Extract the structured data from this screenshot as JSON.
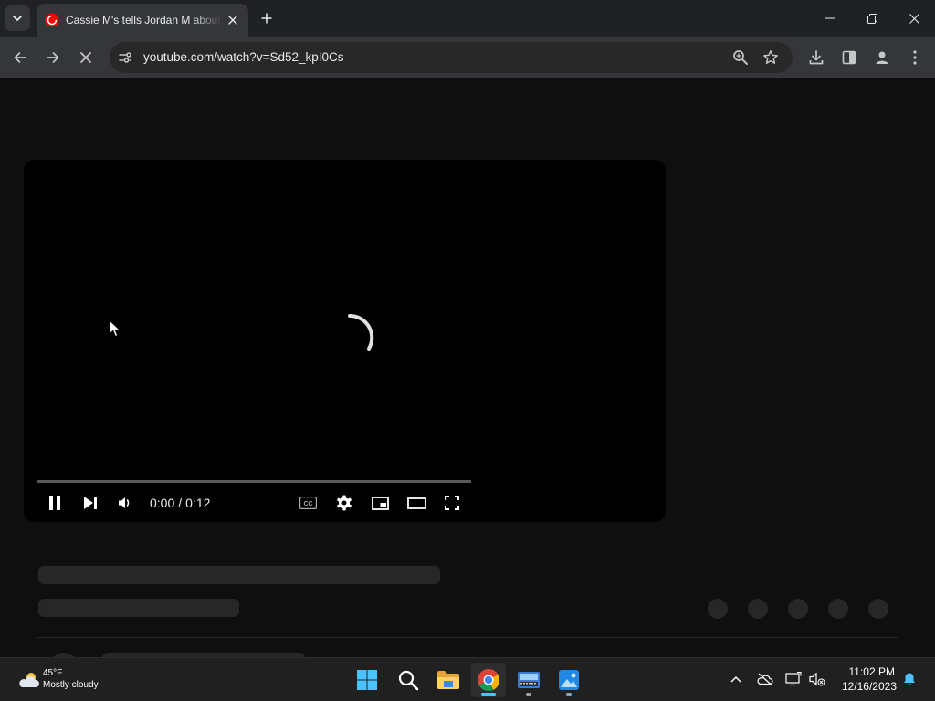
{
  "browser": {
    "tab": {
      "title": "Cassie M's tells Jordan M about the"
    },
    "omnibox": {
      "url": "youtube.com/watch?v=Sd52_kpI0Cs"
    }
  },
  "player": {
    "time": {
      "current": "0:00",
      "separator": "/",
      "duration": "0:12"
    },
    "progress": 0
  },
  "taskbar": {
    "weather": {
      "temperature": "45°F",
      "condition": "Mostly cloudy"
    },
    "clock": {
      "time": "11:02 PM",
      "date": "12/16/2023"
    }
  },
  "colors": {
    "page_bg": "#0f0f0f",
    "chrome_dark": "#202124",
    "toolbar": "#35363a",
    "omnibox": "#282828",
    "skeleton": "#272727",
    "youtube_red": "#ff0000",
    "accent_blue": "#4cc2ff"
  },
  "icons": [
    "tab-search-icon",
    "youtube-favicon",
    "close-icon",
    "plus-icon",
    "minimize-icon",
    "restore-icon",
    "back-arrow-icon",
    "forward-arrow-icon",
    "stop-loading-icon",
    "site-info-icon",
    "zoom-icon",
    "star-icon",
    "download-icon",
    "side-panel-icon",
    "profile-icon",
    "kebab-menu-icon",
    "loading-spinner-icon",
    "pause-icon",
    "next-icon",
    "volume-icon",
    "captions-icon",
    "settings-gear-icon",
    "miniplayer-icon",
    "theater-mode-icon",
    "fullscreen-icon",
    "weather-cloudy-icon",
    "windows-start-icon",
    "search-icon",
    "file-explorer-icon",
    "chrome-icon",
    "keyboard-app-icon",
    "photos-icon",
    "chevron-up-icon",
    "cloud-offline-icon",
    "display-icon",
    "speaker-muted-icon",
    "bell-icon",
    "mouse-cursor-icon"
  ]
}
